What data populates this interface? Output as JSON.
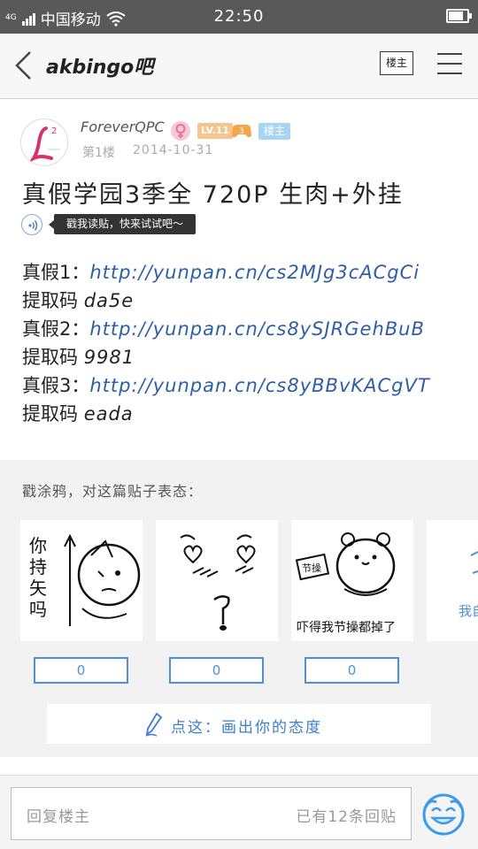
{
  "status_bar": {
    "network": "4G",
    "carrier": "中国移动",
    "time": "22:50",
    "battery_fraction": 0.8
  },
  "nav": {
    "title": "akbingo吧",
    "lz_only_label": "楼主",
    "icons": [
      "back-arrow-icon",
      "menu-icon"
    ]
  },
  "post": {
    "username": "ForeverQPC",
    "level": "LV.11",
    "medal_number": "3",
    "author_tag": "楼主",
    "floor": "第1楼",
    "date": "2014-10-31",
    "title": "真假学园3季全 720P 生肉+外挂",
    "voice_tip": "戳我读贴，快来试试吧～",
    "content": [
      {
        "label": "真假1：",
        "link": "http://yunpan.cn/cs2MJg3cACgCi"
      },
      {
        "label": "提取码 ",
        "value": "da5e"
      },
      {
        "label": "真假2：",
        "link": "http://yunpan.cn/cs8ySJRGehBuB"
      },
      {
        "label": "提取码 ",
        "value": "9981"
      },
      {
        "label": "真假3：",
        "link": "http://yunpan.cn/cs8yBBvKACgVT"
      },
      {
        "label": "提取码 ",
        "value": "eada"
      }
    ]
  },
  "doodle": {
    "heading": "戳涂鸦，对这篇贴子表态：",
    "cards": [
      {
        "caption": "你持矢吗",
        "count": "0"
      },
      {
        "caption": "",
        "count": "0"
      },
      {
        "caption": "吓得我节操都掉了",
        "stamp": "节操",
        "count": "0"
      },
      {
        "caption": "我自"
      }
    ],
    "draw_button": "点这：画出你的态度"
  },
  "reply_bar": {
    "placeholder": "回复楼主",
    "reply_count": "已有12条回贴",
    "emoji_icon": "smiley-face-icon"
  },
  "colors": {
    "link": "#2e5ea8",
    "accent_blue": "#4d8fd9",
    "lz_tag": "#a9d5f5",
    "level_badge": "#f6c48e",
    "gender": "#e8739a",
    "status_bar": "#595959"
  }
}
